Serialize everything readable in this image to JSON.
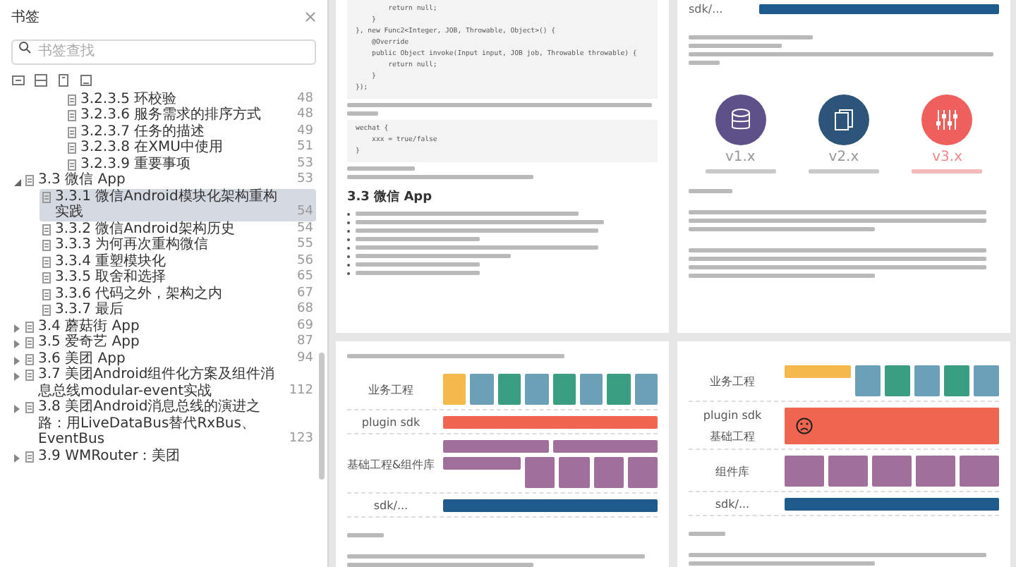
{
  "sidebar": {
    "title": "书签",
    "search": {
      "placeholder": "书签查找"
    },
    "continued_items": [
      {
        "label": "3.2.3.5 环校验",
        "page": "48",
        "selected": false
      },
      {
        "label": "3.2.3.6 服务需求的排序方式",
        "page": "48",
        "selected": false
      },
      {
        "label": "3.2.3.7 任务的描述",
        "page": "49",
        "selected": false
      },
      {
        "label": "3.2.3.8 在XMU中使用",
        "page": "51",
        "selected": false
      },
      {
        "label": "3.2.3.9 重要事项",
        "page": "53",
        "selected": false
      }
    ],
    "items": [
      {
        "label": "3.3 微信 App",
        "page": "53",
        "expanded": true,
        "selected": false,
        "children": [
          {
            "label": "3.3.1 微信Android模块化架构重构实践",
            "page": "54",
            "selected": true
          },
          {
            "label": "3.3.2 微信Android架构历史",
            "page": "54",
            "selected": false
          },
          {
            "label": "3.3.3 为何再次重构微信",
            "page": "55",
            "selected": false
          },
          {
            "label": "3.3.4 重塑模块化",
            "page": "56",
            "selected": false
          },
          {
            "label": "3.3.5 取舍和选择",
            "page": "65",
            "selected": false
          },
          {
            "label": "3.3.6 代码之外，架构之内",
            "page": "67",
            "selected": false
          },
          {
            "label": "3.3.7 最后",
            "page": "68",
            "selected": false
          }
        ]
      },
      {
        "label": "3.4 蘑菇街 App",
        "page": "69",
        "expanded": false,
        "selected": false
      },
      {
        "label": "3.5 爱奇艺 App",
        "page": "87",
        "expanded": false,
        "selected": false
      },
      {
        "label": "3.6 美团 App",
        "page": "94",
        "expanded": false,
        "selected": false
      },
      {
        "label": "3.7 美团Android组件化方案及组件消息总线modular-event实战",
        "page": "112",
        "expanded": false,
        "selected": false
      },
      {
        "label": "3.8 美团Android消息总线的演进之路：用LiveDataBus替代RxBus、EventBus",
        "page": "123",
        "expanded": false,
        "selected": false
      },
      {
        "label": "3.9 WMRouter：美团",
        "expanded": false,
        "selected": false
      }
    ]
  },
  "pages": [
    {
      "kind": "code",
      "code": [
        "        return null;",
        "    }",
        "}, new Func2<Integer, JOB, Throwable, Object>() {",
        "    @Override",
        "    public Object invoke(Input input, JOB job, Throwable throwable) {",
        "        return null;",
        "    }",
        "});"
      ],
      "code_2": [
        "wechat {",
        "    xxx = true/false",
        "}"
      ],
      "heading": "3.3 微信 App"
    },
    {
      "kind": "versions",
      "sdk_label": "sdk/...",
      "versions": [
        {
          "label": "v1.x",
          "color": "#5e5189",
          "highlighted": false
        },
        {
          "label": "v2.x",
          "color": "#2d5479",
          "highlighted": false
        },
        {
          "label": "v3.x",
          "color": "#ef5f5c",
          "highlighted": true
        }
      ]
    },
    {
      "kind": "architecture",
      "layers": [
        {
          "labels": [
            "业务工程"
          ],
          "rows": [
            {
              "blocks": [
                {
                  "kind": "module",
                  "color": "#f4b94a"
                },
                {
                  "kind": "module",
                  "color": "#6c9fb8"
                },
                {
                  "kind": "module",
                  "color": "#3a9e82"
                },
                {
                  "kind": "module",
                  "color": "#6c9fb8"
                },
                {
                  "kind": "module",
                  "color": "#3a9e82"
                },
                {
                  "kind": "module",
                  "color": "#6c9fb8"
                },
                {
                  "kind": "module",
                  "color": "#3a9e82"
                },
                {
                  "kind": "module",
                  "color": "#6c9fb8"
                }
              ]
            }
          ]
        },
        {
          "labels": [
            "plugin sdk"
          ],
          "rows": [
            {
              "blocks": [
                {
                  "kind": "bar",
                  "color": "#ef6650"
                }
              ]
            }
          ]
        },
        {
          "labels": [
            "基础工程&组件库"
          ],
          "rows": [
            {
              "blocks": [
                {
                  "kind": "wide",
                  "color": "#a0709a"
                },
                {
                  "kind": "wide",
                  "color": "#a0709a"
                }
              ]
            },
            {
              "blocks": [
                {
                  "kind": "wide",
                  "color": "#a0709a"
                },
                {
                  "kind": "module",
                  "color": "#a0709a"
                },
                {
                  "kind": "module",
                  "color": "#a0709a"
                },
                {
                  "kind": "module",
                  "color": "#a0709a"
                },
                {
                  "kind": "module",
                  "color": "#a0709a"
                }
              ]
            }
          ]
        },
        {
          "labels": [
            "sdk/..."
          ],
          "rows": [
            {
              "blocks": [
                {
                  "kind": "bar",
                  "color": "#1f5a8c"
                }
              ]
            }
          ]
        }
      ]
    },
    {
      "kind": "architecture",
      "layers": [
        {
          "labels": [
            "业务工程"
          ],
          "rows": [
            {
              "blocks": [
                {
                  "kind": "wide",
                  "color": "#f4b94a"
                },
                {
                  "kind": "module",
                  "color": "#6c9fb8"
                },
                {
                  "kind": "module",
                  "color": "#3a9e82"
                },
                {
                  "kind": "module",
                  "color": "#6c9fb8"
                },
                {
                  "kind": "module",
                  "color": "#3a9e82"
                },
                {
                  "kind": "module",
                  "color": "#6c9fb8"
                }
              ]
            }
          ]
        },
        {
          "labels": [
            "plugin sdk",
            "基础工程"
          ],
          "rows": [
            {
              "blocks": [
                {
                  "kind": "sad",
                  "color": "#ef6650"
                }
              ]
            }
          ]
        },
        {
          "labels": [
            "组件库"
          ],
          "rows": [
            {
              "blocks": [
                {
                  "kind": "module",
                  "color": "#a0709a"
                },
                {
                  "kind": "module",
                  "color": "#a0709a"
                },
                {
                  "kind": "module",
                  "color": "#a0709a"
                },
                {
                  "kind": "module",
                  "color": "#a0709a"
                },
                {
                  "kind": "module",
                  "color": "#a0709a"
                }
              ]
            }
          ]
        },
        {
          "labels": [
            "sdk/..."
          ],
          "rows": [
            {
              "blocks": [
                {
                  "kind": "bar",
                  "color": "#1f5a8c"
                }
              ]
            }
          ]
        }
      ]
    }
  ]
}
